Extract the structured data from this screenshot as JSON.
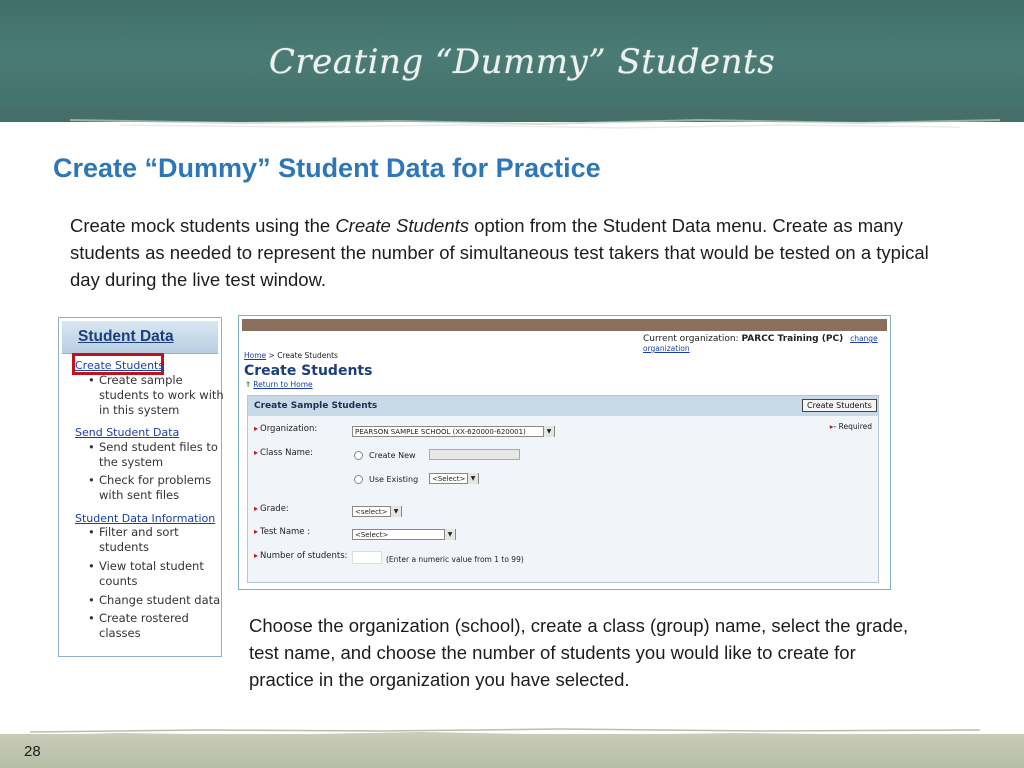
{
  "slide": {
    "title": "Creating “Dummy” Students",
    "heading": "Create “Dummy” Student Data for Practice",
    "intro_before": "Create mock students using the ",
    "intro_em": "Create Students",
    "intro_after": " option from the Student Data menu. Create as many students as needed to represent the number of simultaneous test takers that would be tested on a typical day during the live test window.",
    "caption": "Choose the organization (school), create a class (group) name, select the grade, test name, and choose the number of students you would like to create for practice in the organization you have selected.",
    "page_number": "28"
  },
  "menu": {
    "header": "Student Data",
    "items": [
      {
        "link": "Create Students",
        "bullets": [
          "Create sample students to work with in this system"
        ]
      },
      {
        "link": "Send Student Data",
        "bullets": [
          "Send student files to the system",
          "Check for problems with sent files"
        ]
      },
      {
        "link": "Student Data Information",
        "bullets": [
          "Filter and sort students",
          "View total student counts",
          "Change student data",
          "Create rostered classes"
        ]
      }
    ]
  },
  "form": {
    "current_org_label": "Current organization:",
    "current_org_value": "PARCC Training (PC)",
    "change_org_link": "change organization",
    "breadcrumb_home": "Home",
    "breadcrumb_rest": " > Create Students",
    "page_title": "Create Students",
    "return_link": "Return to Home",
    "panel_title": "Create Sample Students",
    "submit_label": "Create Students",
    "required_note": "- Required",
    "fields": {
      "organization_label": "Organization:",
      "organization_value": "PEARSON SAMPLE SCHOOL (XX-620000-620001)",
      "class_name_label": "Class Name:",
      "create_new_label": "Create New",
      "use_existing_label": "Use Existing",
      "use_existing_value": "<Select>",
      "grade_label": "Grade:",
      "grade_value": "<select>",
      "test_name_label": "Test Name :",
      "test_name_value": "<Select>",
      "num_students_label": "Number of students:",
      "num_students_hint": "(Enter a numeric value from 1 to 99)"
    }
  },
  "colors": {
    "chalkboard": "#4a7b74",
    "heading_blue": "#2e77b6",
    "highlight_red": "#c0121a"
  }
}
